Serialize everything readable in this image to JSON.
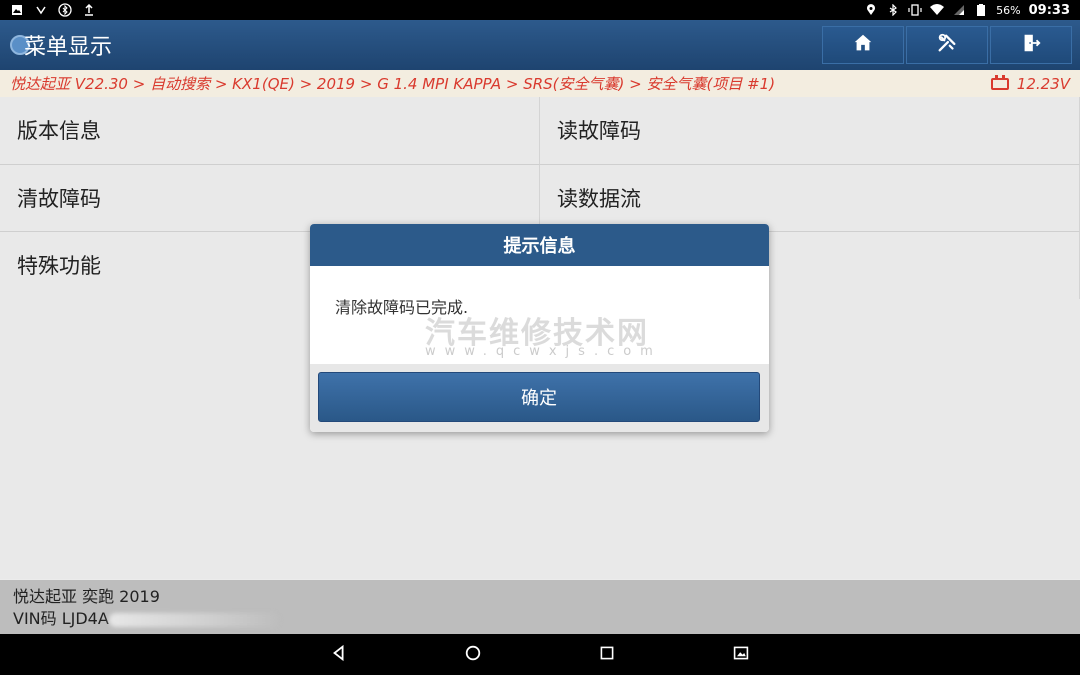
{
  "status_bar": {
    "battery_percent": "56%",
    "time": "09:33"
  },
  "header": {
    "title": "菜单显示",
    "buttons": [
      {
        "icon": "home-icon"
      },
      {
        "icon": "tools-icon"
      },
      {
        "icon": "exit-icon"
      }
    ]
  },
  "breadcrumb": {
    "path": "悦达起亚 V22.30 > 自动搜索 > KX1(QE) > 2019 > G 1.4 MPI KAPPA > SRS(安全气囊) > 安全气囊(项目 #1)",
    "voltage": "12.23V"
  },
  "menu": {
    "items": [
      {
        "label": "版本信息"
      },
      {
        "label": "读故障码"
      },
      {
        "label": "清故障码"
      },
      {
        "label": "读数据流"
      },
      {
        "label": "特殊功能"
      },
      {
        "label": ""
      }
    ]
  },
  "vehicle_info": {
    "model": "悦达起亚 奕跑 2019",
    "vin_label": "VIN码 LJD4A"
  },
  "dialog": {
    "title": "提示信息",
    "message": "清除故障码已完成.",
    "watermark": "汽车维修技术网",
    "watermark_url": "www.qcwxjs.com",
    "ok_label": "确定"
  },
  "colors": {
    "header_bg": "#1e4470",
    "breadcrumb_text": "#d93a2e",
    "dialog_title_bg": "#2c5a8a"
  }
}
